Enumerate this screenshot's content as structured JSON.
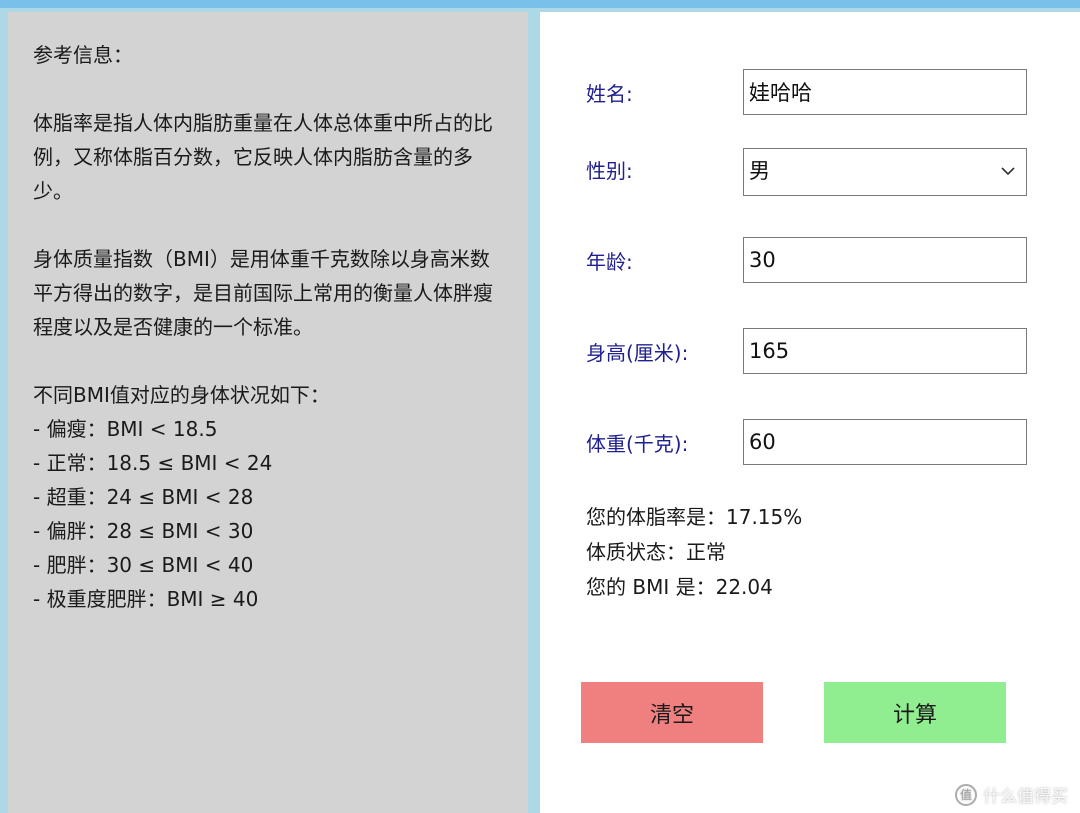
{
  "reference": {
    "title": "参考信息：",
    "body_fat_desc": "体脂率是指人体内脂肪重量在人体总体重中所占的比例，又称体脂百分数，它反映人体内脂肪含量的多少。",
    "bmi_desc": "身体质量指数（BMI）是用体重千克数除以身高米数平方得出的数字，是目前国际上常用的衡量人体胖瘦程度以及是否健康的一个标准。",
    "bmi_list_title": "不同BMI值对应的身体状况如下：",
    "bmi_list": [
      "- 偏瘦：BMI < 18.5",
      "- 正常：18.5 ≤ BMI  <  24",
      "- 超重：24 ≤ BMI  <  28",
      "- 偏胖：28 ≤ BMI  <  30",
      "- 肥胖：30 ≤ BMI  <  40",
      "- 极重度肥胖：BMI ≥ 40"
    ]
  },
  "form": {
    "name_label": "姓名:",
    "name_value": "娃哈哈",
    "gender_label": "性别:",
    "gender_value": "男",
    "age_label": "年龄:",
    "age_value": "30",
    "height_label": "身高(厘米):",
    "height_value": "165",
    "weight_label": "体重(千克):",
    "weight_value": "60"
  },
  "results": {
    "body_fat": "您的体脂率是：17.15%",
    "status": "体质状态：正常",
    "bmi": "您的 BMI 是：22.04"
  },
  "buttons": {
    "clear_label": "清空",
    "calc_label": "计算"
  },
  "watermark": {
    "icon_text": "值",
    "text": "什么值得买"
  }
}
